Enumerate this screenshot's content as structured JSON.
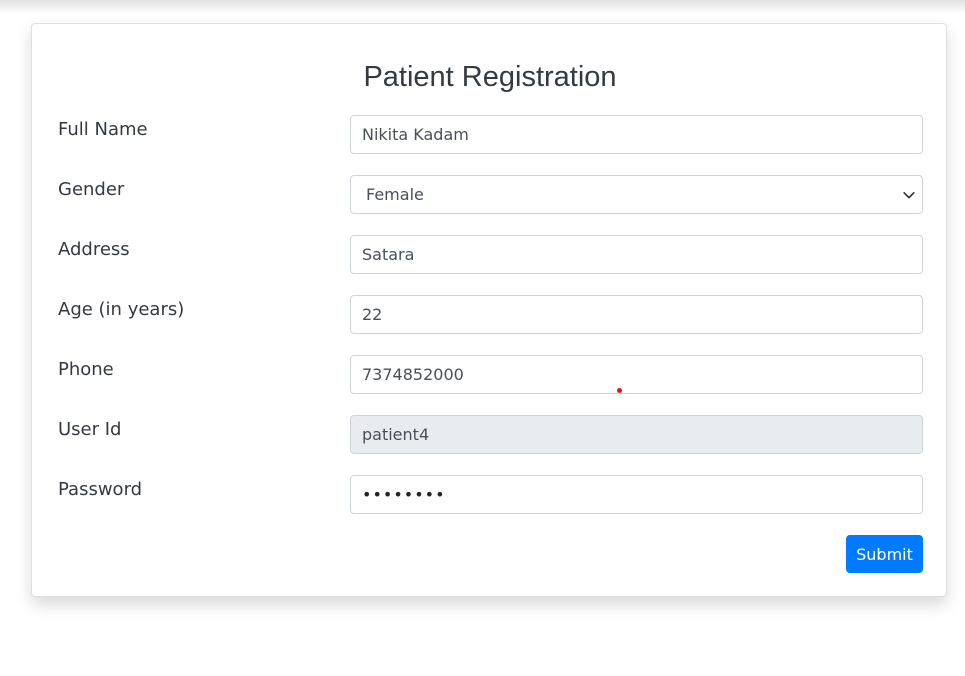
{
  "form": {
    "title": "Patient Registration",
    "fields": [
      {
        "label": "Full Name",
        "value": "Nikita Kadam",
        "type": "text"
      },
      {
        "label": "Gender",
        "value": "Female",
        "type": "select"
      },
      {
        "label": "Address",
        "value": "Satara",
        "type": "text"
      },
      {
        "label": "Age (in years)",
        "value": "22",
        "type": "text"
      },
      {
        "label": "Phone",
        "value": "7374852000",
        "type": "text"
      },
      {
        "label": "User Id",
        "value": "patient4",
        "type": "readonly"
      },
      {
        "label": "Password",
        "value": "••••••••",
        "type": "password"
      }
    ],
    "submit_label": "Submit"
  },
  "icons": {
    "select_arrow": "chevron-down-icon"
  },
  "colors": {
    "primary": "#007bff",
    "readonly_bg": "#e9ecef",
    "border": "#ced4da",
    "pointer_dot": "#e8141b"
  }
}
